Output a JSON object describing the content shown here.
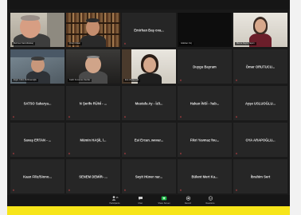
{
  "window": {
    "app": "Zoom",
    "view": "Gallery View"
  },
  "colors": {
    "background": "#1a1a1a",
    "tile": "#262626",
    "accent_yellow": "#f7e51a",
    "share_green": "#1fbf4b",
    "muted_red": "#e5484d"
  },
  "tiles": {
    "r0": [
      {
        "label": "Mehmet Sait Altıkulaç"
      },
      {
        "label": "Onur Özkan"
      },
      {
        "name": "Emirhan Baş ova...",
        "label": ""
      },
      {
        "label": "Gökhan Orç"
      },
      {
        "label": "Merve Kayra Yapıcı"
      }
    ],
    "r1": [
      {
        "label": "Ergin Yıldız Pehlivanoğlu"
      },
      {
        "label": "Kadir Kocaman Serdar"
      },
      {
        "label": "Ece Zorba Gök"
      },
      {
        "name": "Duygu Bayram"
      },
      {
        "name": "Ömer ORUTUCU..."
      }
    ],
    "r2": [
      {
        "name": "SATSO Sakarya..."
      },
      {
        "name": "N Şerife RÜNİ - ..."
      },
      {
        "name": "Mustafa Ay - İzli..."
      },
      {
        "name": "Hakan İNSİ - hab..."
      },
      {
        "name": "Ayşe USLUOĞLU..."
      }
    ],
    "r3": [
      {
        "name": "Savaş ERTAN - ..."
      },
      {
        "name": "Mümin HAŞİL /..."
      },
      {
        "name": "Esi Ercan_wevar..."
      },
      {
        "name": "Fikri Yavmaz fou..."
      },
      {
        "name": "OYA ARAPOĞLU..."
      }
    ],
    "r4": [
      {
        "name": "Kaan Filiz/Siono..."
      },
      {
        "name": "SENEM DEMİR- ..."
      },
      {
        "name": "Seyit Hüner nar..."
      },
      {
        "name": "Bülent Mert Ka..."
      },
      {
        "name": "İbrahim Sert"
      }
    ]
  },
  "toolbar": {
    "participants": {
      "label": "Participants",
      "count": "35",
      "icon": "participants-icon"
    },
    "chat": {
      "label": "Chat",
      "icon": "chat-icon"
    },
    "share": {
      "label": "Share Screen",
      "icon": "share-screen-icon"
    },
    "record": {
      "label": "Record",
      "icon": "record-icon"
    },
    "reactions": {
      "label": "Reactions",
      "icon": "reactions-icon"
    }
  }
}
